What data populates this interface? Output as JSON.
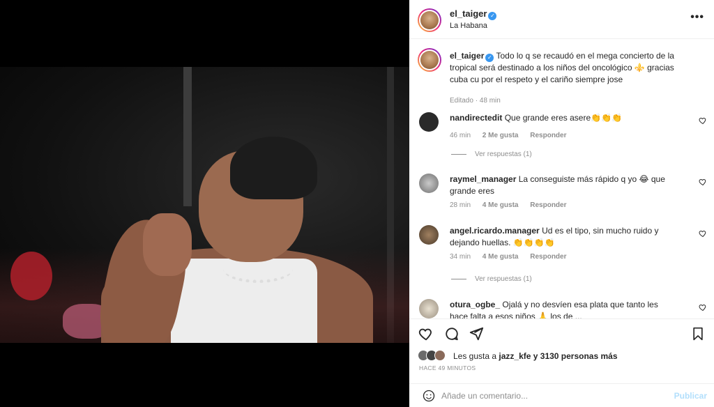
{
  "post": {
    "username": "el_taiger",
    "location": "La Habana",
    "caption_text": "Todo lo q se recaudó en el mega concierto de la tropical será destinado a los niños del oncológico ⚜️ gracias cuba cu por el respeto y el cariño siempre jose",
    "caption_meta": "Editado · 48 min"
  },
  "comments": [
    {
      "user": "nandirectedit",
      "text": "Que grande eres asere👏👏👏",
      "time": "46 min",
      "likes": "2 Me gusta",
      "reply": "Responder",
      "view_replies": "Ver respuestas (1)"
    },
    {
      "user": "raymel_manager",
      "text": "La conseguiste más rápido q yo 😂 que grande eres",
      "time": "28 min",
      "likes": "4 Me gusta",
      "reply": "Responder"
    },
    {
      "user": "angel.ricardo.manager",
      "text": "Ud es el tipo, sin mucho ruido y dejando huellas. 👏👏👏👏",
      "time": "34 min",
      "likes": "4 Me gusta",
      "reply": "Responder",
      "view_replies": "Ver respuestas (1)"
    },
    {
      "user": "otura_ogbe_",
      "text": "Ojalá y no desvíen esa plata que tanto les hace falta a esos niños 🙏 los de ...",
      "time": "",
      "likes": "",
      "reply": ""
    }
  ],
  "likes": {
    "prefix": "Les gusta a",
    "user": "jazz_kfe",
    "suffix": "y 3130 personas más"
  },
  "posted_ago": "HACE 49 MINUTOS",
  "add_comment": {
    "placeholder": "Añade un comentario...",
    "publish": "Publicar"
  },
  "icons": [
    "heart-icon",
    "comment-icon",
    "share-icon",
    "bookmark-icon",
    "emoji-icon",
    "more-icon",
    "verified-icon"
  ],
  "colors": {
    "accent": "#0095f6",
    "verified": "#3897f0",
    "muted": "#8e8e8e",
    "publish_disabled": "#b2dffc"
  }
}
